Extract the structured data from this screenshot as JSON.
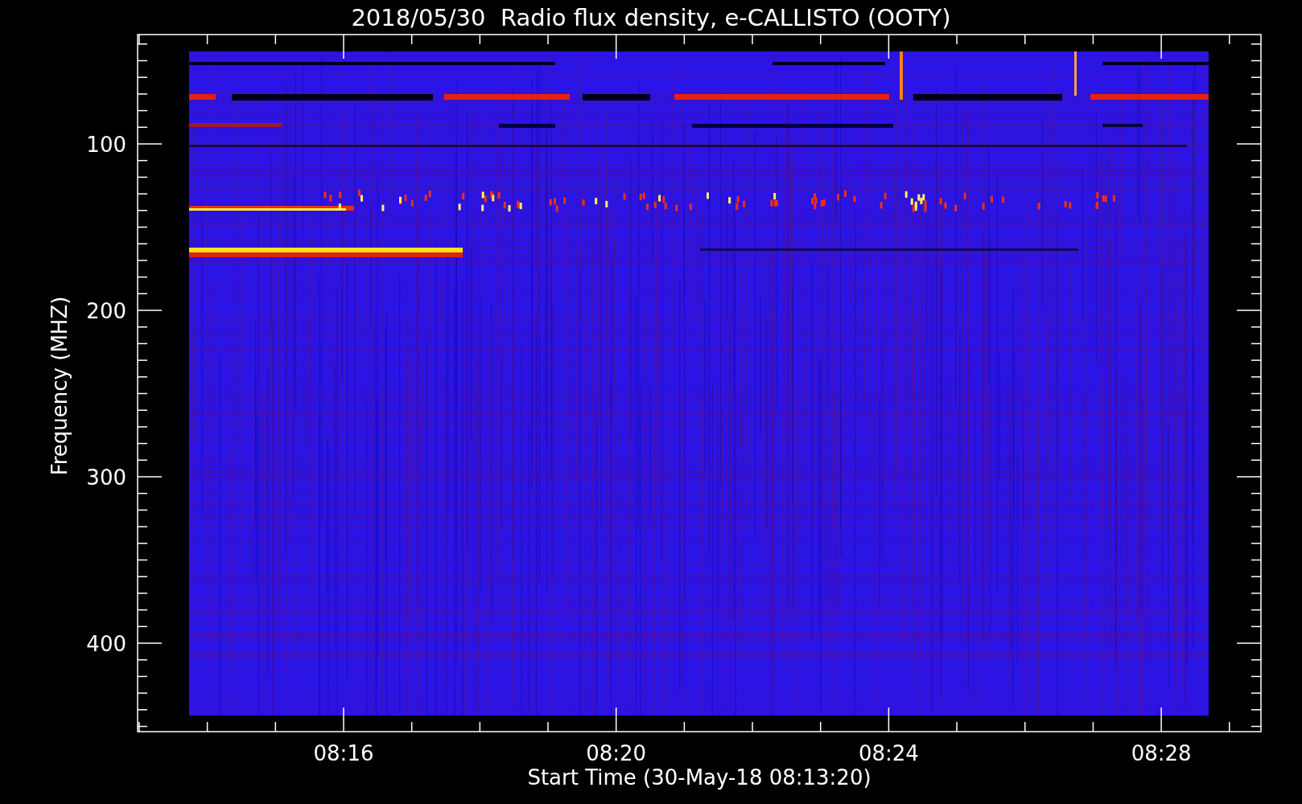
{
  "title": "2018/05/30  Radio flux density, e-CALLISTO (OOTY)",
  "y_axis": {
    "label": "Frequency (MHZ)",
    "ticks": [
      "100",
      "200",
      "300",
      "400"
    ]
  },
  "x_axis": {
    "label": "Start Time (30-May-18 08:13:20)",
    "ticks": [
      "08:16",
      "08:20",
      "08:24",
      "08:28"
    ]
  }
}
